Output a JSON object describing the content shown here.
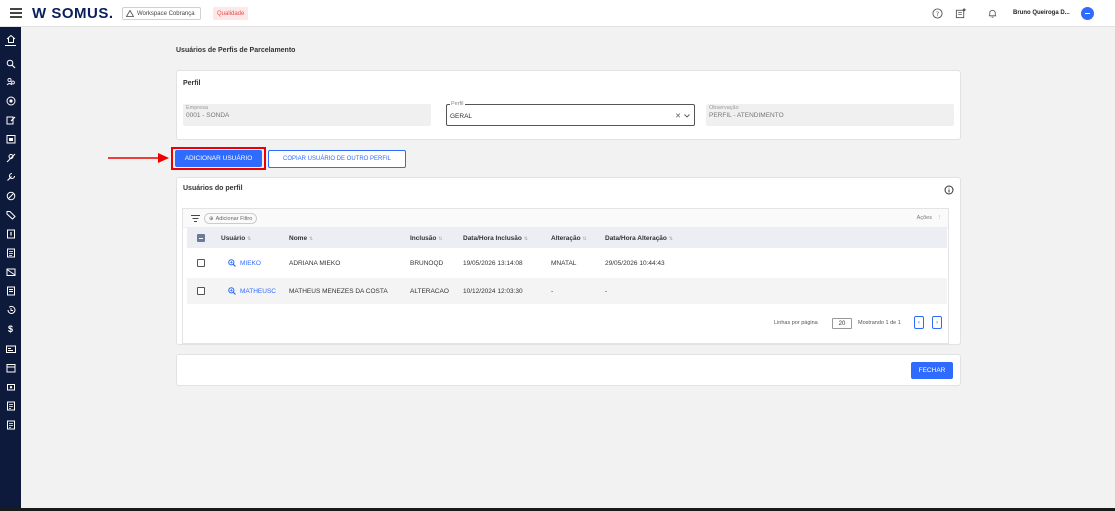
{
  "header": {
    "brand": "W SOMUS.",
    "workspace": "Workspace Cobrança",
    "env_badge": "Qualidade",
    "user_name": "Bruno Queiroga D..."
  },
  "sidebar": {
    "icons": [
      "home-icon",
      "search-icon",
      "users-icon",
      "add-circle-icon",
      "edit-icon",
      "calendar-icon",
      "block-user-icon",
      "tools-icon",
      "cancel-icon",
      "tag-icon",
      "document-icon",
      "report-icon",
      "mail-icon",
      "list-icon",
      "history-icon",
      "dollar-icon",
      "card-icon",
      "calendar-icon",
      "cash-icon",
      "file-icon",
      "file-icon"
    ]
  },
  "page": {
    "title": "Usuários de Perfis de Parcelamento"
  },
  "perfil": {
    "section_title": "Perfil",
    "empresa": {
      "label": "Empresa",
      "value": "0001 - SONDA"
    },
    "perfil": {
      "label": "Perfil",
      "value": "GERAL"
    },
    "observacao": {
      "label": "Observação",
      "value": "PERFIL - ATENDIMENTO"
    }
  },
  "actions": {
    "add_user": "ADICIONAR USUÁRIO",
    "copy_user": "COPIAR USUÁRIO DE OUTRO PERFIL",
    "close": "FECHAR"
  },
  "users": {
    "section_title": "Usuários do perfil",
    "add_filter": "Adicionar Filtro",
    "actions_label": "Ações",
    "columns": [
      "Usuário",
      "Nome",
      "Inclusão",
      "Data/Hora Inclusão",
      "Alteração",
      "Data/Hora Alteração"
    ],
    "rows": [
      {
        "usuario": "MIEKO",
        "nome": "ADRIANA MIEKO",
        "inclusao": "BRUNOQD",
        "dh_inclusao": "19/05/2026 13:14:08",
        "alteracao": "MNATAL",
        "dh_alteracao": "29/05/2026 10:44:43"
      },
      {
        "usuario": "MATHEUSC",
        "nome": "MATHEUS MENEZES DA COSTA",
        "inclusao": "ALTERACAO",
        "dh_inclusao": "10/12/2024 12:03:30",
        "alteracao": "-",
        "dh_alteracao": "-"
      }
    ],
    "pagination": {
      "rows_per_page_label": "Linhas por página",
      "rows_per_page": "20",
      "showing": "Mostrando 1 de 1"
    }
  },
  "colors": {
    "primary": "#2f6bff",
    "sidebar": "#0e1a3c",
    "highlight": "#e00000"
  }
}
